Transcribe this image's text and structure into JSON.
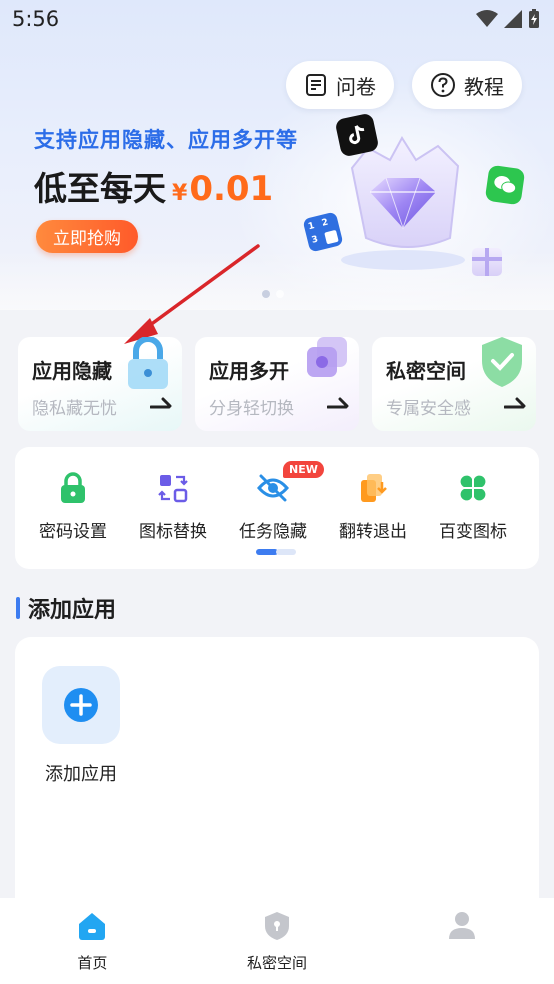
{
  "status_bar": {
    "time": "5:56",
    "icons": [
      "wifi-icon",
      "signal-icon",
      "battery-charging-icon"
    ]
  },
  "header": {
    "survey_label": "问卷",
    "tutorial_label": "教程"
  },
  "banner": {
    "subtitle": "支持应用隐藏、应用多开等",
    "headline": "低至每天",
    "currency": "¥",
    "price": "0.01",
    "buy_label": "立即抢购",
    "slides": 2,
    "active_slide": 2
  },
  "feature_cards": [
    {
      "title": "应用隐藏",
      "subtitle": "隐私藏无忧",
      "icon": "lock-icon"
    },
    {
      "title": "应用多开",
      "subtitle": "分身轻切换",
      "icon": "layers-icon"
    },
    {
      "title": "私密空间",
      "subtitle": "专属安全感",
      "icon": "shield-check-icon"
    }
  ],
  "tools": [
    {
      "label": "密码设置",
      "icon": "lock-icon",
      "color": "#2fc26b"
    },
    {
      "label": "图标替换",
      "icon": "swap-icon",
      "color": "#6b5ce7"
    },
    {
      "label": "任务隐藏",
      "icon": "eye-off-icon",
      "color": "#2a8fe6",
      "badge": "NEW"
    },
    {
      "label": "翻转退出",
      "icon": "flip-exit-icon",
      "color": "#ff9a1f"
    },
    {
      "label": "百变图标",
      "icon": "clover-icon",
      "color": "#2fc26b"
    }
  ],
  "section": {
    "title": "添加应用"
  },
  "apps": {
    "add_label": "添加应用"
  },
  "bottom_nav": [
    {
      "label": "首页",
      "icon": "home-icon",
      "active": true
    },
    {
      "label": "私密空间",
      "icon": "shield-icon",
      "active": false
    },
    {
      "label": "",
      "icon": "profile-icon",
      "active": false
    }
  ],
  "colors": {
    "accent": "#3d7cf0",
    "banner_subtitle": "#2c6de8",
    "price": "#ff6a1a",
    "annotation_arrow": "#d9262a"
  }
}
